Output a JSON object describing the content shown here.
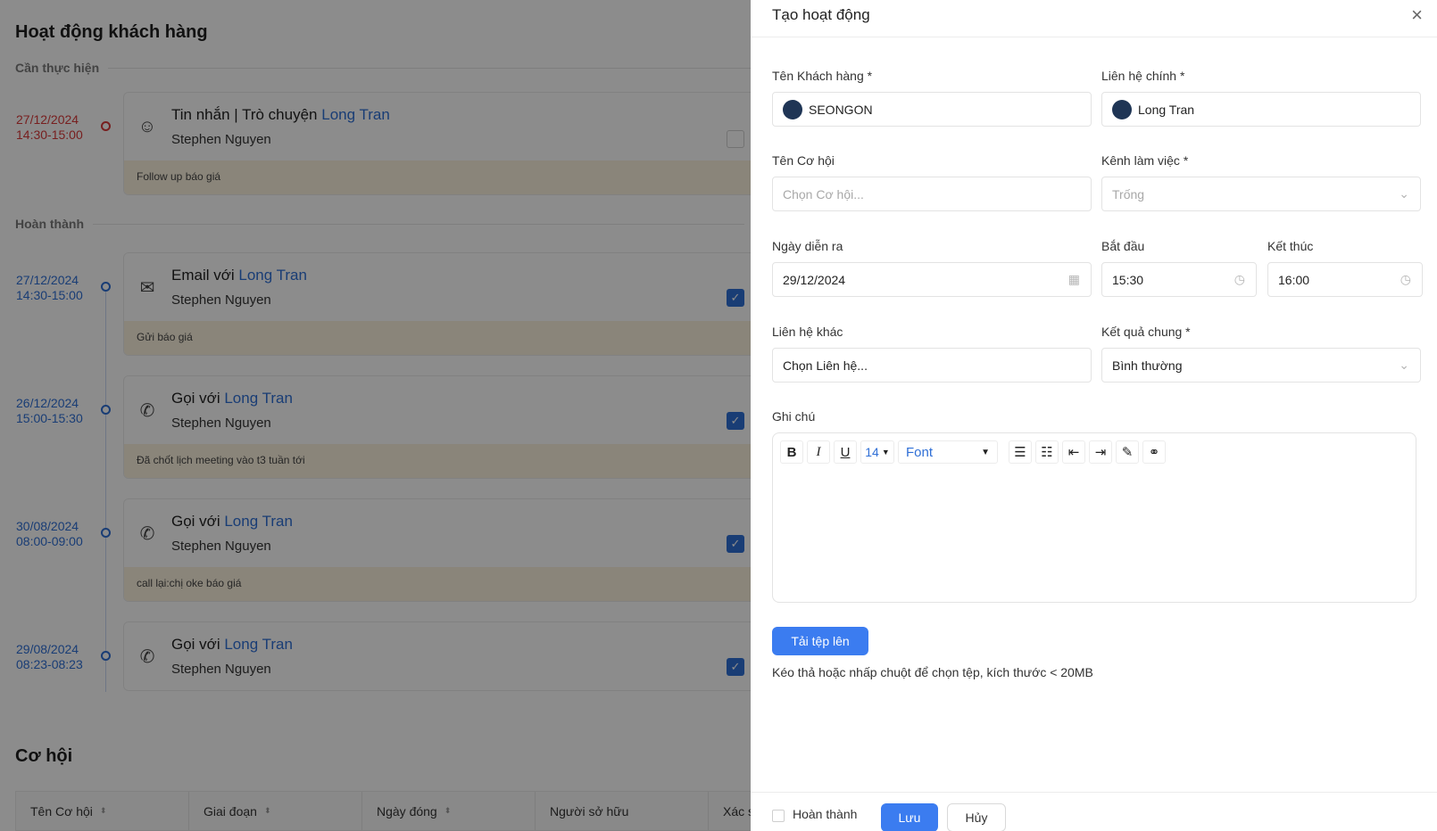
{
  "page": {
    "title": "Hoạt động khách hàng",
    "pending_label": "Cần thực hiện",
    "done_label": "Hoàn thành"
  },
  "activities": [
    {
      "date": "27/12/2024",
      "time": "14:30-15:00",
      "kind": "Tin nhắn | Trò chuyện",
      "contact": "Long Tran",
      "owner": "Stephen Nguyen",
      "note": "Follow up báo giá",
      "done": false,
      "icon": "chat-icon"
    },
    {
      "date": "27/12/2024",
      "time": "14:30-15:00",
      "kind": "Email với",
      "contact": "Long Tran",
      "owner": "Stephen Nguyen",
      "note": "Gửi báo giá",
      "done": true,
      "icon": "mail-icon"
    },
    {
      "date": "26/12/2024",
      "time": "15:00-15:30",
      "kind": "Gọi với",
      "contact": "Long Tran",
      "owner": "Stephen Nguyen",
      "note": "Đã chốt lịch meeting vào t3 tuần tới",
      "done": true,
      "icon": "phone-icon"
    },
    {
      "date": "30/08/2024",
      "time": "08:00-09:00",
      "kind": "Gọi với",
      "contact": "Long Tran",
      "owner": "Stephen Nguyen",
      "note": "call lại:chị oke báo giá",
      "done": true,
      "icon": "phone-icon"
    },
    {
      "date": "29/08/2024",
      "time": "08:23-08:23",
      "kind": "Gọi với",
      "contact": "Long Tran",
      "owner": "Stephen Nguyen",
      "note": "",
      "done": true,
      "icon": "phone-icon"
    }
  ],
  "opportunities": {
    "title": "Cơ hội",
    "columns": [
      "Tên Cơ hội",
      "Giai đoạn",
      "Ngày đóng",
      "Người sở hữu",
      "Xác s"
    ]
  },
  "drawer": {
    "title": "Tạo hoạt động",
    "customer_label": "Tên Khách hàng *",
    "customer_value": "SEONGON",
    "contact_label": "Liên hệ chính *",
    "contact_value": "Long Tran",
    "opportunity_label": "Tên Cơ hội",
    "opportunity_placeholder": "Chọn Cơ hội...",
    "channel_label": "Kênh làm việc *",
    "channel_placeholder": "Trống",
    "date_label": "Ngày diễn ra",
    "date_value": "29/12/2024",
    "start_label": "Bắt đầu",
    "start_value": "15:30",
    "end_label": "Kết thúc",
    "end_value": "16:00",
    "other_contact_label": "Liên hệ khác",
    "other_contact_value": "Chọn Liên hệ...",
    "result_label": "Kết quả chung *",
    "result_value": "Bình thường",
    "notes_label": "Ghi chú",
    "font_size": "14",
    "font_label": "Font",
    "upload_label": "Tải tệp lên",
    "upload_hint": "Kéo thả hoặc nhấp chuột để chọn tệp, kích thước < 20MB",
    "complete_label": "Hoàn thành",
    "save_label": "Lưu",
    "cancel_label": "Hủy"
  }
}
